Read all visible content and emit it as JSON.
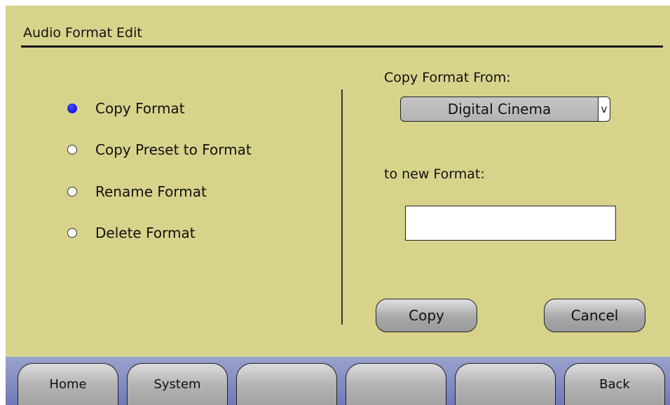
{
  "header": {
    "title": "Audio Format Edit"
  },
  "options": [
    {
      "label": "Copy Format",
      "selected": true
    },
    {
      "label": "Copy Preset to Format",
      "selected": false
    },
    {
      "label": "Rename Format",
      "selected": false
    },
    {
      "label": "Delete Format",
      "selected": false
    }
  ],
  "form": {
    "copy_from_label": "Copy Format From:",
    "copy_from_value": "Digital Cinema",
    "dropdown_arrow": "v",
    "new_format_label": "to new Format:",
    "new_format_value": ""
  },
  "actions": {
    "copy": "Copy",
    "cancel": "Cancel"
  },
  "nav": {
    "home": "Home",
    "system": "System",
    "blank1": "",
    "blank2": "",
    "blank3": "",
    "back": "Back"
  },
  "colors": {
    "panel_background": "#d7d38b",
    "radio_selected": "#0000d8",
    "navbar": "#7f88c0"
  },
  "icons": {
    "selected_radio": "radio-selected-icon",
    "unselected_radio": "radio-unselected-icon"
  }
}
